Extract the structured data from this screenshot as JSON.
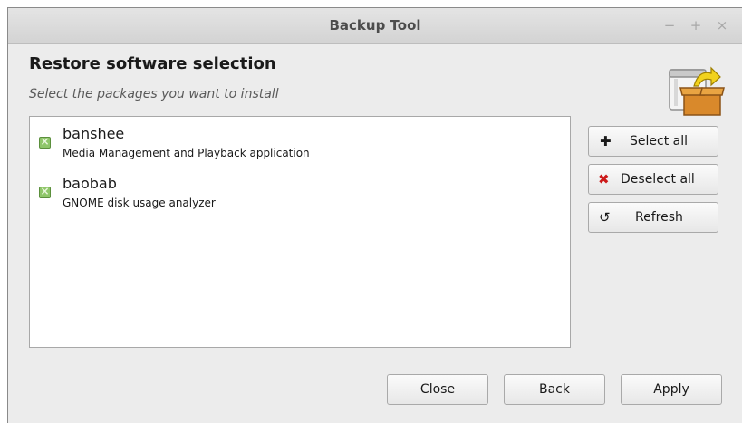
{
  "window": {
    "title": "Backup Tool",
    "controls": {
      "minimize": "−",
      "maximize": "+",
      "close": "×"
    }
  },
  "header": {
    "title": "Restore software selection",
    "subtitle": "Select the packages you want to install",
    "icon": "backup-box-icon"
  },
  "packages": [
    {
      "name": "banshee",
      "description": "Media Management and Playback application",
      "checked": true
    },
    {
      "name": "baobab",
      "description": "GNOME disk usage analyzer",
      "checked": true
    }
  ],
  "side_buttons": {
    "select_all": {
      "label": "Select all",
      "icon": "plus-icon"
    },
    "deselect_all": {
      "label": "Deselect all",
      "icon": "red-x-icon"
    },
    "refresh": {
      "label": "Refresh",
      "icon": "refresh-icon"
    }
  },
  "footer": {
    "close_label": "Close",
    "back_label": "Back",
    "apply_label": "Apply"
  },
  "colors": {
    "deselect_icon": "#cc1a1a",
    "checkbox": "#8fc66a"
  }
}
